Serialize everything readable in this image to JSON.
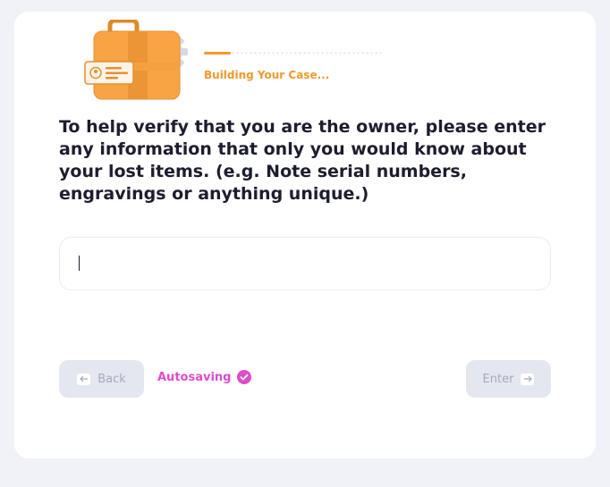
{
  "progress": {
    "status_text": "Building Your Case...",
    "fraction": 0.15,
    "color": "#f59a2b"
  },
  "question": {
    "text": "To help verify that you are the owner, please enter any information that only you would know about your lost items. (e.g. Note serial numbers, engravings or anything unique.)"
  },
  "answer_input": {
    "value": "",
    "placeholder": ""
  },
  "footer": {
    "back_label": "Back",
    "enter_label": "Enter",
    "autosave_label": "Autosaving",
    "autosave_color": "#df4ccc"
  },
  "icons": {
    "illustration": "briefcase-with-gear-icon",
    "back": "arrow-left-icon",
    "enter": "arrow-right-icon",
    "autosave": "check-circle-icon"
  }
}
